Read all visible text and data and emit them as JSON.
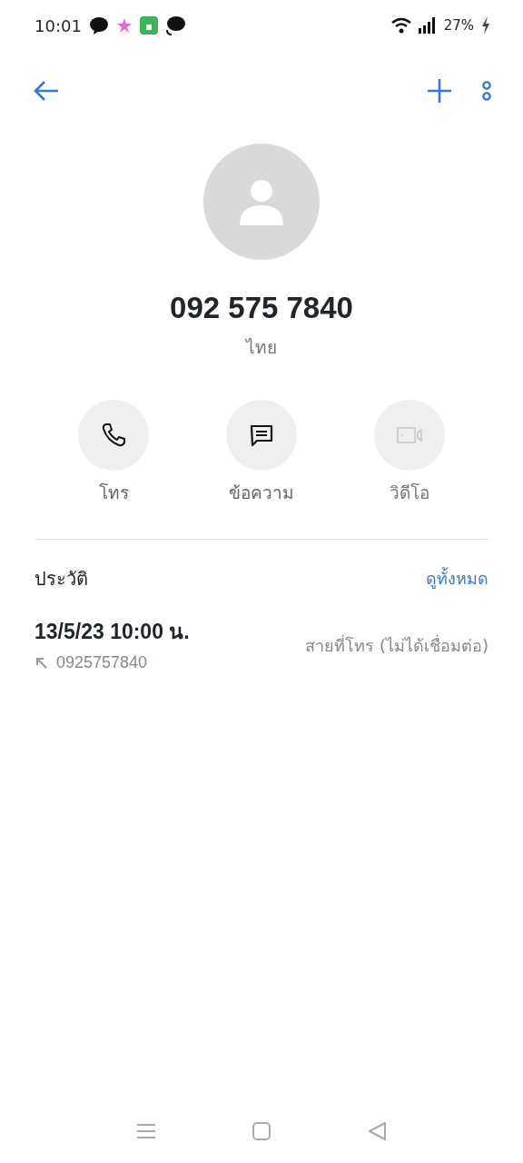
{
  "status_bar": {
    "time": "10:01",
    "battery": "27%",
    "charging": true
  },
  "contact": {
    "number": "092 575 7840",
    "country": "ไทย"
  },
  "actions": [
    {
      "kind": "call",
      "label": "โทร",
      "disabled": false
    },
    {
      "kind": "message",
      "label": "ข้อความ",
      "disabled": false
    },
    {
      "kind": "video",
      "label": "วิดีโอ",
      "disabled": true
    }
  ],
  "history": {
    "title": "ประวัติ",
    "see_all": "ดูทั้งหมด",
    "entries": [
      {
        "datetime": "13/5/23 10:00 น.",
        "number": "0925757840",
        "status": "สายที่โทร (ไม่ได้เชื่อมต่อ)",
        "kind": "outgoing"
      }
    ]
  }
}
